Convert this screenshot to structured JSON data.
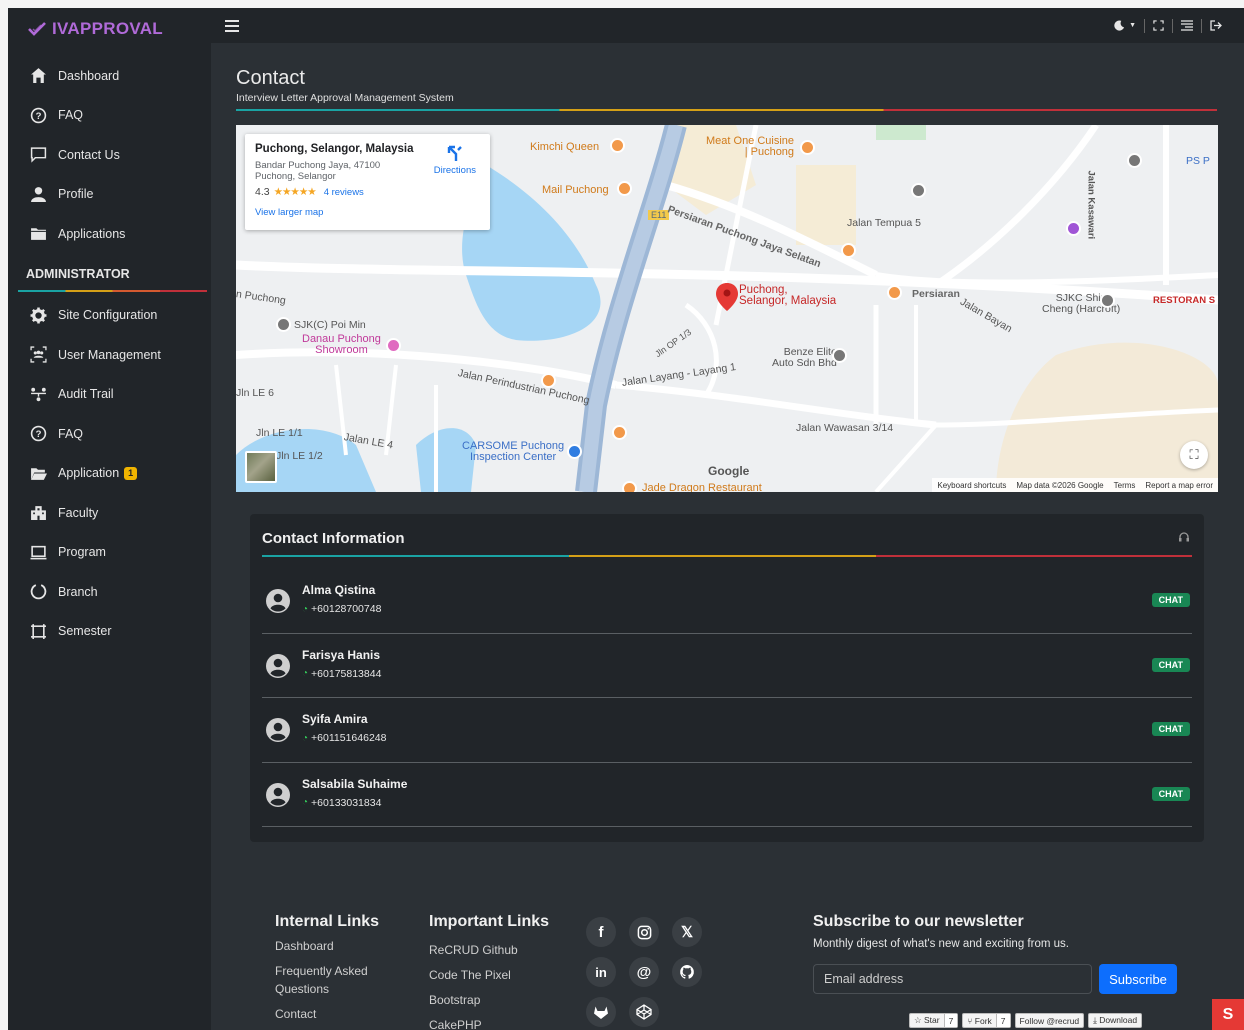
{
  "brand": {
    "name": "IVAPPROVAL"
  },
  "sidebar": {
    "items": [
      {
        "label": "Dashboard",
        "icon": "home-icon"
      },
      {
        "label": "FAQ",
        "icon": "question-icon"
      },
      {
        "label": "Contact Us",
        "icon": "chat-icon"
      },
      {
        "label": "Profile",
        "icon": "user-icon"
      },
      {
        "label": "Applications",
        "icon": "folder-icon"
      }
    ],
    "section": "ADMINISTRATOR",
    "admin_items": [
      {
        "label": "Site Configuration",
        "icon": "gear-icon"
      },
      {
        "label": "User Management",
        "icon": "users-icon"
      },
      {
        "label": "Audit Trail",
        "icon": "hierarchy-icon"
      },
      {
        "label": "FAQ",
        "icon": "question-icon"
      },
      {
        "label": "Application",
        "icon": "folder-open-icon",
        "badge": "1"
      },
      {
        "label": "Faculty",
        "icon": "building-icon"
      },
      {
        "label": "Program",
        "icon": "laptop-icon"
      },
      {
        "label": "Branch",
        "icon": "circle-icon"
      },
      {
        "label": "Semester",
        "icon": "frame-icon"
      }
    ]
  },
  "page": {
    "title": "Contact",
    "subtitle": "Interview Letter Approval Management System"
  },
  "map": {
    "place_name": "Puchong, Selangor, Malaysia",
    "address_line1": "Bandar Puchong Jaya, 47100",
    "address_line2": "Puchong, Selangor",
    "rating": "4.3",
    "stars": "★★★★★",
    "reviews": "4 reviews",
    "larger_map": "View larger map",
    "directions": "Directions",
    "pin_label_1": "Puchong,",
    "pin_label_2": "Selangor, Malaysia",
    "labels": {
      "kimchi": "Kimchi Queen",
      "meatone1": "Meat One Cuisine",
      "meatone2": "| Puchong",
      "mail": "Mail Puchong",
      "persiaran_puchong": "Persiaran Puchong Jaya Selatan",
      "jalan_tempua5": "Jalan Tempua 5",
      "jalan_kasawari": "Jalan Kasawari",
      "sjkc_shin": "SJKC Shin",
      "cheng": "Cheng (Harcroft)",
      "restoran": "RESTORAN S",
      "sjkc_poimin": "SJK(C) Poi Min",
      "danau1": "Danau Puchong",
      "danau2": "Showroom",
      "jalan_perindustrian": "Jalan Perindustrian Puchong",
      "jalan_layang": "Jalan Layang - Layang 1",
      "benze1": "Benze Elite",
      "benze2": "Auto Sdn Bhd",
      "carsome1": "CARSOME Puchong",
      "carsome2": "Inspection Center",
      "jalan_wawasan": "Jalan Wawasan 3/14",
      "jade": "Jade Dragon Restaurant",
      "jln_le6": "Jln LE 6",
      "jln_le11": "Jln LE 1/1",
      "jln_le12": "Jln LE 1/2",
      "jalan_le4": "Jalan LE 4",
      "n_puchong": "n Puchong",
      "ps": "PS P",
      "jalan_bayan": "Jalan Bayan",
      "jln_op": "Jln OP 1/3",
      "e11": "E11",
      "persiaran": "Persiaran"
    },
    "google": "Google",
    "attrib": [
      "Keyboard shortcuts",
      "Map data ©2026 Google",
      "Terms",
      "Report a map error"
    ]
  },
  "contact": {
    "title": "Contact Information",
    "chat_label": "CHAT",
    "people": [
      {
        "name": "Alma Qistina",
        "phone": "+60128700748"
      },
      {
        "name": "Farisya Hanis",
        "phone": "+60175813844"
      },
      {
        "name": "Syifa Amira",
        "phone": "+601151646248"
      },
      {
        "name": "Salsabila Suhaime",
        "phone": "+60133031834"
      }
    ]
  },
  "footer": {
    "internal_title": "Internal Links",
    "internal": [
      "Dashboard",
      "Frequently Asked Questions",
      "Contact"
    ],
    "important_title": "Important Links",
    "important": [
      "ReCRUD Github",
      "Code The Pixel",
      "Bootstrap",
      "CakePHP"
    ],
    "social": [
      "facebook-icon",
      "instagram-icon",
      "x-icon",
      "linkedin-icon",
      "threads-icon",
      "github-icon",
      "gitlab-icon",
      "codepen-icon"
    ],
    "newsletter_title": "Subscribe to our newsletter",
    "newsletter_desc": "Monthly digest of what's new and exciting from us.",
    "email_placeholder": "Email address",
    "subscribe": "Subscribe",
    "gh": {
      "star": "Star",
      "star_count": "7",
      "fork": "Fork",
      "fork_count": "7",
      "follow": "Follow @recrud",
      "download": "Download"
    }
  },
  "colors": {
    "sidebar_bg": "#212529",
    "main_bg": "#2b3035",
    "brand": "#b06ad8",
    "chat": "#198754",
    "subscribe": "#0d6efd"
  }
}
